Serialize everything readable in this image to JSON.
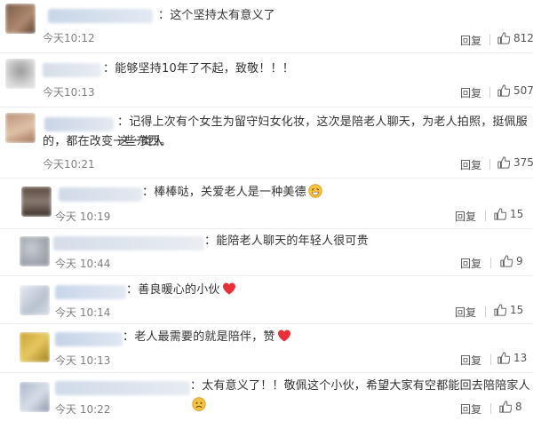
{
  "comments": [
    {
      "text": "：这个坚持太有意义了",
      "time": "今天10:12",
      "reply": "回复",
      "likes": "812"
    },
    {
      "text": "：能够坚持10年了不起，致敬！！！",
      "time": "今天10:13",
      "reply": "回复",
      "likes": "507"
    },
    {
      "text": "：记得上次有个女生为留守妇女化妆，这次是陪老人聊天，为老人拍照，挺佩服这一类人",
      "text2": "的，都在改变一些东西。",
      "time": "今天10:21",
      "reply": "回复",
      "likes": "375"
    },
    {
      "text": "：棒棒哒，关爱老人是一种美德",
      "emoji": "grin-emoji",
      "time": "今天 10:19",
      "reply": "回复",
      "likes": "15"
    },
    {
      "text": "：能陪老人聊天的年轻人很可贵",
      "time": "今天 10:44",
      "reply": "回复",
      "likes": "9"
    },
    {
      "text": "：善良暖心的小伙",
      "emoji": "heart-emoji",
      "time": "今天 10:14",
      "reply": "回复",
      "likes": "15"
    },
    {
      "text": "：老人最需要的就是陪伴，赞",
      "emoji": "heart-emoji",
      "time": "今天 10:13",
      "reply": "回复",
      "likes": "13"
    },
    {
      "text": "：太有意义了！！敬佩这个小伙，希望大家有空都能回去陪陪家人",
      "emoji": "sad-emoji",
      "time": "今天 10:22",
      "reply": "回复",
      "likes": "8"
    }
  ],
  "colors": {
    "heart": "#e8303a",
    "emoji_face": "#f7c23c",
    "time": "#808080"
  }
}
